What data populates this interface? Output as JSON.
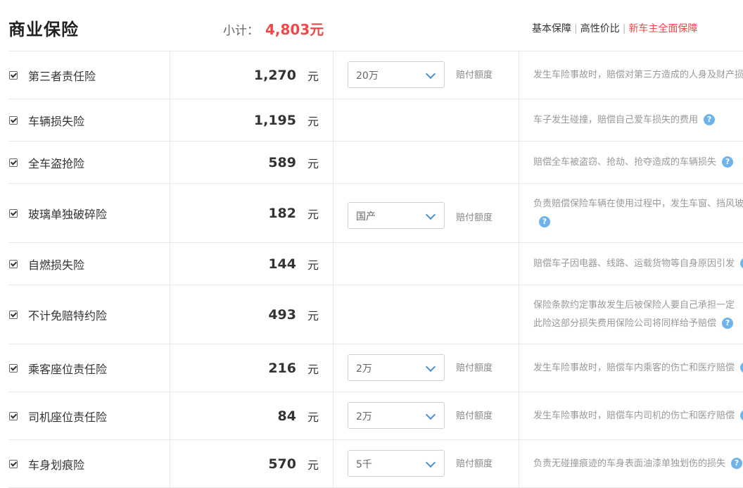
{
  "header": {
    "title": "商业保险",
    "subtotal_label": "小计：",
    "subtotal_value": "4,803元",
    "plans": [
      "基本保障",
      "高性价比",
      "新车主全面保障"
    ]
  },
  "colors": {
    "accent_red": "#f04848",
    "help_blue": "#6fb3ea",
    "chevron_blue": "#4a90d9"
  },
  "icons": {
    "checkbox": "checked-checkbox-icon",
    "select": "chevron-down-icon",
    "help": "question-mark-icon"
  },
  "unit": "元",
  "limit_label": "赔付额度",
  "help_glyph": "?",
  "rows": [
    {
      "name": "第三者责任险",
      "price": "1,270",
      "select": "20万",
      "desc": [
        "发生车险事故时，赔偿对第三方造成的人身及财产损失"
      ]
    },
    {
      "name": "车辆损失险",
      "price": "1,195",
      "desc": [
        "车子发生碰撞，赔偿自己爱车损失的费用"
      ]
    },
    {
      "name": "全车盗抢险",
      "price": "589",
      "desc": [
        "赔偿全车被盗窃、抢劫、抢夺造成的车辆损失"
      ]
    },
    {
      "name": "玻璃单独破碎险",
      "price": "182",
      "select": "国产",
      "desc": [
        "负责赔偿保险车辆在使用过程中，发生车窗、挡风玻璃",
        ""
      ]
    },
    {
      "name": "自燃损失险",
      "price": "144",
      "desc": [
        "赔偿车子因电器、线路、运载货物等自身原因引发"
      ]
    },
    {
      "name": "不计免赔特约险",
      "price": "493",
      "desc": [
        "保险条款约定事故发生后被保险人要自己承担一定",
        "此险这部分损失费用保险公司将同样给予赔偿"
      ]
    },
    {
      "name": "乘客座位责任险",
      "price": "216",
      "select": "2万",
      "desc": [
        "发生车险事故时，赔偿车内乘客的伤亡和医疗赔偿"
      ]
    },
    {
      "name": "司机座位责任险",
      "price": "84",
      "select": "2万",
      "desc": [
        "发生车险事故时，赔偿车内司机的伤亡和医疗赔偿"
      ]
    },
    {
      "name": "车身划痕险",
      "price": "570",
      "select": "5千",
      "desc": [
        "负责无碰撞痕迹的车身表面油漆单独划伤的损失"
      ]
    }
  ]
}
